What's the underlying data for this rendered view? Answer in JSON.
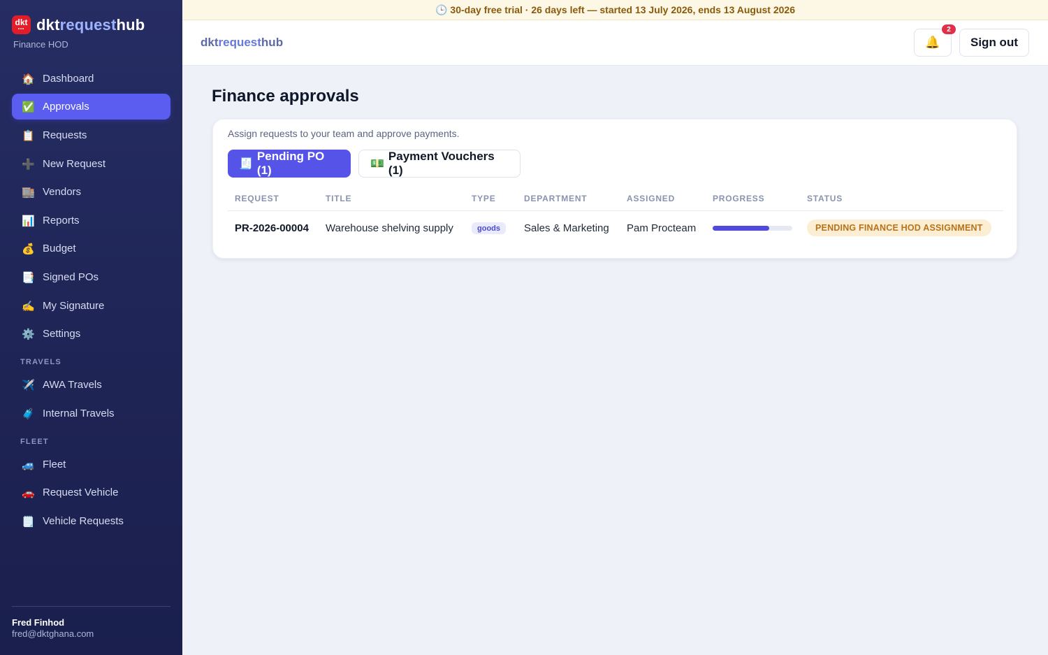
{
  "sidebar": {
    "logo": {
      "text": "dkt",
      "dots": "•••"
    },
    "brand": {
      "part1": "dkt",
      "part2": "request",
      "part3": "hub"
    },
    "role": "Finance HOD",
    "items": [
      {
        "icon": "🏠",
        "label": "Dashboard"
      },
      {
        "icon": "✅",
        "label": "Approvals"
      },
      {
        "icon": "📋",
        "label": "Requests"
      },
      {
        "icon": "➕",
        "label": "New Request"
      },
      {
        "icon": "🏬",
        "label": "Vendors"
      },
      {
        "icon": "📊",
        "label": "Reports"
      },
      {
        "icon": "💰",
        "label": "Budget"
      },
      {
        "icon": "📑",
        "label": "Signed POs"
      },
      {
        "icon": "✍️",
        "label": "My Signature"
      },
      {
        "icon": "⚙️",
        "label": "Settings"
      }
    ],
    "travels": {
      "label": "TRAVELS",
      "items": [
        {
          "icon": "✈️",
          "label": "AWA Travels"
        },
        {
          "icon": "🧳",
          "label": "Internal Travels"
        }
      ]
    },
    "fleet": {
      "label": "FLEET",
      "items": [
        {
          "icon": "🚙",
          "label": "Fleet"
        },
        {
          "icon": "🚗",
          "label": "Request Vehicle"
        },
        {
          "icon": "🗒️",
          "label": "Vehicle Requests"
        }
      ]
    },
    "user": {
      "name": "Fred Finhod",
      "email": "fred@dktghana.com"
    }
  },
  "banner": {
    "icon": "🕒",
    "text": "30-day free trial · 26 days left — started 13 July 2026, ends 13 August 2026"
  },
  "topbar": {
    "brand": {
      "part1": "dkt",
      "part2": "request",
      "part3": "hub"
    },
    "bell_icon": "🔔",
    "notification_count": "2",
    "sign_out": "Sign out"
  },
  "main": {
    "title": "Finance approvals",
    "description": "Assign requests to your team and approve payments.",
    "tabs": [
      {
        "icon": "🧾",
        "label": "Pending PO (1)"
      },
      {
        "icon": "💵",
        "label": "Payment Vouchers (1)"
      }
    ],
    "columns": [
      "REQUEST",
      "TITLE",
      "TYPE",
      "DEPARTMENT",
      "ASSIGNED",
      "PROGRESS",
      "STATUS"
    ],
    "rows": [
      {
        "request": "PR-2026-00004",
        "title": "Warehouse shelving supply",
        "type": "goods",
        "department": "Sales & Marketing",
        "assigned": "Pam Procteam",
        "progress": 0.71,
        "status": "PENDING FINANCE HOD ASSIGNMENT"
      }
    ]
  },
  "colors": {
    "accent": "#5b5cf0",
    "sidebar_bg": "#1f2556",
    "status_bg": "#fbeed3",
    "status_text": "#b8721a",
    "badge_red": "#e0314b"
  }
}
